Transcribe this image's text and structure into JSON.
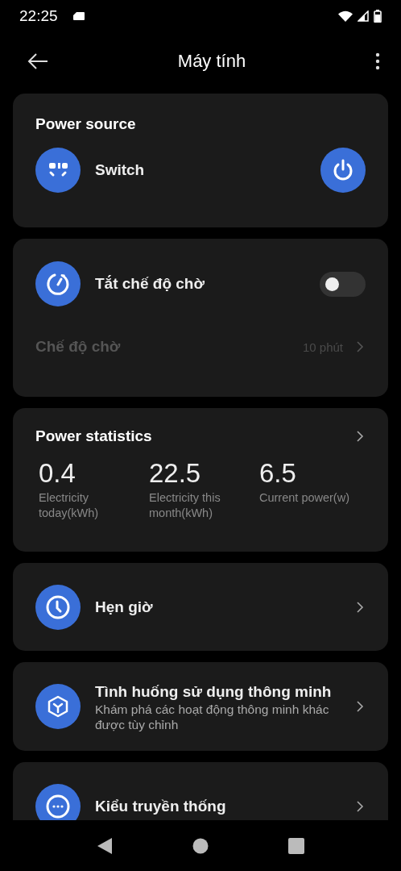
{
  "status_bar": {
    "time": "22:25"
  },
  "app_bar": {
    "title": "Máy tính"
  },
  "cards": [
    {
      "kind": "power",
      "title": "Power source",
      "label": "Switch",
      "on": true
    },
    {
      "kind": "standby",
      "label": "Tắt chế độ chờ",
      "on": false,
      "sub": {
        "label": "Chế độ chờ",
        "value": "10 phút",
        "disabled": true
      }
    },
    {
      "kind": "stats",
      "title": "Power statistics",
      "stats": [
        {
          "value": "0.4",
          "label": "Electricity today(kWh)"
        },
        {
          "value": "22.5",
          "label": "Electricity this month(kWh)"
        },
        {
          "value": "6.5",
          "label": "Current power(w)"
        }
      ]
    },
    {
      "kind": "timer",
      "label": "Hẹn giờ"
    },
    {
      "kind": "scene",
      "label": "Tình huống sử dụng thông minh",
      "description": "Khám phá các hoạt động thông minh khác được tùy chỉnh"
    },
    {
      "kind": "mode",
      "label": "Kiểu truyền thống"
    }
  ]
}
